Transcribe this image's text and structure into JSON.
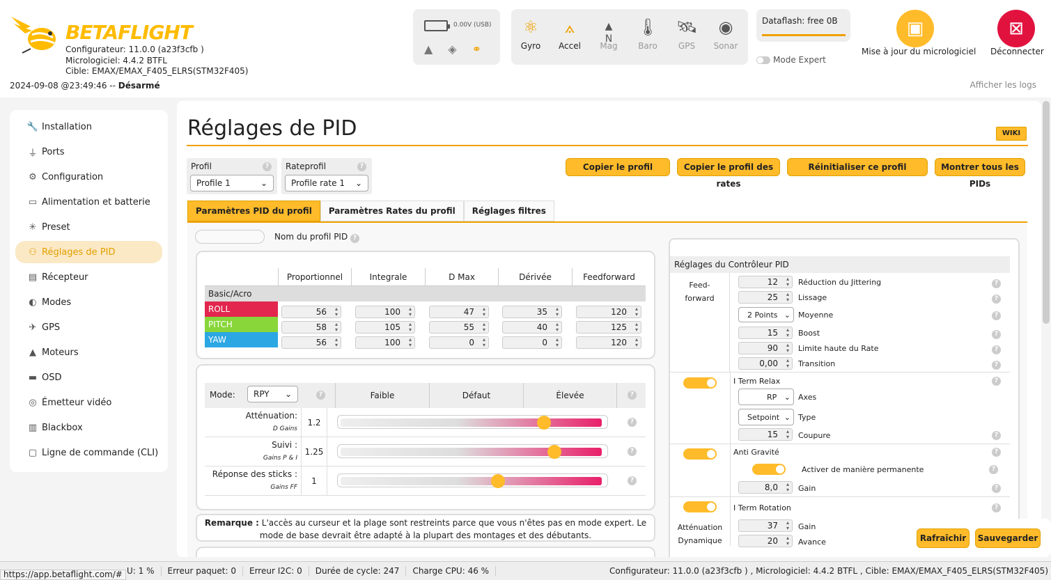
{
  "header": {
    "logo_text": "BETAFLIGHT",
    "configurator": "Configurateur: 11.0.0 (a23f3cfb )",
    "firmware": "Micrologiciel: 4.4.2 BTFL",
    "target": "Cible: EMAX/EMAX_F405_ELRS(STM32F405)",
    "datetime": "2024-09-08 @23:49:46 -- ",
    "arm_state": "Désarmé",
    "show_logs": "Afficher les logs",
    "battery": "0.00V (USB)",
    "sensors": [
      {
        "label": "Gyro",
        "icon": "gyro-icon",
        "on": true
      },
      {
        "label": "Accel",
        "icon": "accel-icon",
        "on": true
      },
      {
        "label": "Mag",
        "icon": "mag-icon",
        "on": false
      },
      {
        "label": "Baro",
        "icon": "baro-icon",
        "on": false
      },
      {
        "label": "GPS",
        "icon": "gps-icon",
        "on": false
      },
      {
        "label": "Sonar",
        "icon": "sonar-icon",
        "on": false
      }
    ],
    "mag_letter": "N",
    "dataflash": "Dataflash: free 0B",
    "expert_mode": "Mode Expert",
    "firmware_update": "Mise à jour du micrologiciel",
    "disconnect": "Déconnecter"
  },
  "sidebar": {
    "items": [
      {
        "label": "Installation",
        "icon": "wrench-icon"
      },
      {
        "label": "Ports",
        "icon": "plug-icon"
      },
      {
        "label": "Configuration",
        "icon": "gear-icon"
      },
      {
        "label": "Alimentation et batterie",
        "icon": "battery-icon"
      },
      {
        "label": "Preset",
        "icon": "wand-icon"
      },
      {
        "label": "Réglages de PID",
        "icon": "pid-icon",
        "active": true
      },
      {
        "label": "Récepteur",
        "icon": "receiver-icon"
      },
      {
        "label": "Modes",
        "icon": "toggle-icon"
      },
      {
        "label": "GPS",
        "icon": "satellite-icon"
      },
      {
        "label": "Moteurs",
        "icon": "motor-icon"
      },
      {
        "label": "OSD",
        "icon": "osd-icon"
      },
      {
        "label": "Émetteur vidéo",
        "icon": "broadcast-icon"
      },
      {
        "label": "Blackbox",
        "icon": "blackbox-icon"
      },
      {
        "label": "Ligne de commande (CLI)",
        "icon": "terminal-icon"
      }
    ]
  },
  "main": {
    "title": "Réglages de PID",
    "wiki": "WIKI",
    "profile_label": "Profil",
    "profile_value": "Profile 1",
    "rateprofile_label": "Rateprofil",
    "rateprofile_value": "Profile rate 1",
    "buttons": [
      "Copier le profil",
      "Copier le profil des rates",
      "Réinitialiser ce profil",
      "Montrer tous les PIDs"
    ],
    "tabs": [
      "Paramètres PID du profil",
      "Paramètres Rates du profil",
      "Réglages filtres"
    ],
    "pid_name_label": "Nom du profil PID",
    "pid_table": {
      "headers": [
        "Proportionnel",
        "Integrale",
        "D Max",
        "Dérivée",
        "Feedforward"
      ],
      "group": "Basic/Acro",
      "rows": [
        {
          "axis": "ROLL",
          "color": "#e2264d",
          "values": [
            "56",
            "100",
            "47",
            "35",
            "120"
          ]
        },
        {
          "axis": "PITCH",
          "color": "#88d63a",
          "values": [
            "58",
            "105",
            "55",
            "40",
            "125"
          ]
        },
        {
          "axis": "YAW",
          "color": "#2ba7e3",
          "values": [
            "56",
            "100",
            "0",
            "0",
            "120"
          ]
        }
      ]
    },
    "sliders": {
      "mode_label": "Mode:",
      "mode_value": "RPY",
      "cols": [
        "Faible",
        "Défaut",
        "Élevée"
      ],
      "rows": [
        {
          "label": "Atténuation:",
          "sub": "D Gains",
          "value": "1.2",
          "position": 0.78
        },
        {
          "label": "Suivi :",
          "sub": "Gains P & I",
          "value": "1.25",
          "position": 0.82
        },
        {
          "label": "Réponse des sticks :",
          "sub": "Gains FF",
          "value": "1",
          "position": 0.6
        }
      ]
    },
    "note_bold": "Remarque :",
    "note_text": " L'accès au curseur et la plage sont restreints parce que vous n'êtes pas en mode expert. Le mode de base devrait être adapté à la plupart des montages et des débutants.",
    "controller": {
      "title": "Réglages du Contrôleur PID",
      "ff_label_1": "Feed-",
      "ff_label_2": "forward",
      "ff_rows": [
        {
          "value": "12",
          "label": "Réduction du Jittering"
        },
        {
          "value": "25",
          "label": "Lissage"
        },
        {
          "value": "2 Points",
          "label": "Moyenne",
          "select": true
        },
        {
          "value": "15",
          "label": "Boost"
        },
        {
          "value": "90",
          "label": "Limite haute du Rate"
        },
        {
          "value": "0,00",
          "label": "Transition"
        }
      ],
      "iterm_relax": "I Term Relax",
      "relax_axes_value": "RP",
      "relax_axes_label": "Axes",
      "relax_type_value": "Setpoint",
      "relax_type_label": "Type",
      "relax_cutoff_value": "15",
      "relax_cutoff_label": "Coupure",
      "anti_gravity": "Anti Gravité",
      "ag_permanent": "Activer de manière permanente",
      "ag_gain_value": "8,0",
      "ag_gain_label": "Gain",
      "iterm_rotation": "I Term Rotation",
      "dyn_label_1": "Atténuation",
      "dyn_label_2": "Dynamique",
      "dyn_gain_value": "37",
      "dyn_gain_label": "Gain",
      "dyn_adv_value": "20",
      "dyn_adv_label": "Avance"
    },
    "refresh": "Rafraîchir",
    "save": "Sauvegarder"
  },
  "status": {
    "packet_error": "Erreur paquet: 0",
    "i2c_error": "Erreur I2C: 0",
    "cycle": "Durée de cycle: 247",
    "cpu": "Charge CPU: 46 %",
    "usage_partial": "U: 1 %",
    "version": "Configurateur: 11.0.0 (a23f3cfb ) , Micrologiciel: 4.4.2 BTFL , Cible: EMAX/EMAX_F405_ELRS(STM32F405)",
    "url": "https://app.betaflight.com/#"
  }
}
